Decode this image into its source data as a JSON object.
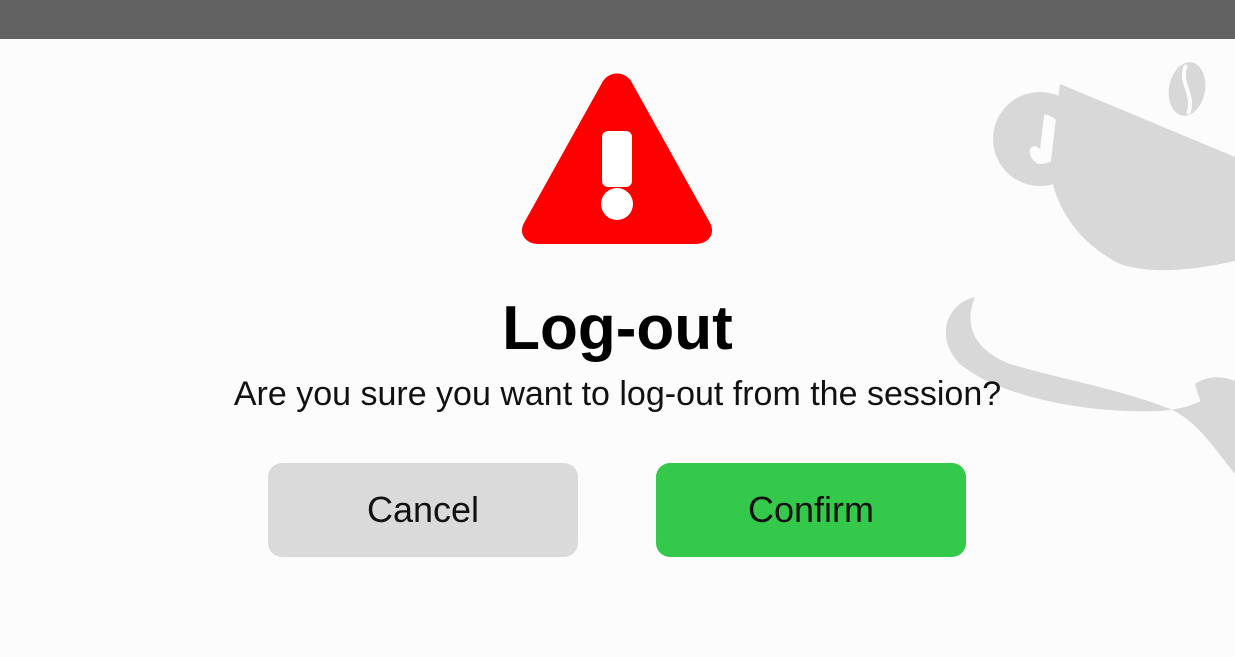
{
  "dialog": {
    "title": "Log-out",
    "message": "Are you sure you want to log-out from the session?",
    "cancel_label": "Cancel",
    "confirm_label": "Confirm"
  },
  "icons": {
    "warning": "warning-triangle-icon",
    "watermark": "coffee-cup-mustache-logo"
  },
  "colors": {
    "top_bar": "#626262",
    "background": "#fcfcfc",
    "warning": "#ff0000",
    "cancel_button": "#dadada",
    "confirm_button": "#35c94c",
    "watermark": "#d8d8d8"
  }
}
